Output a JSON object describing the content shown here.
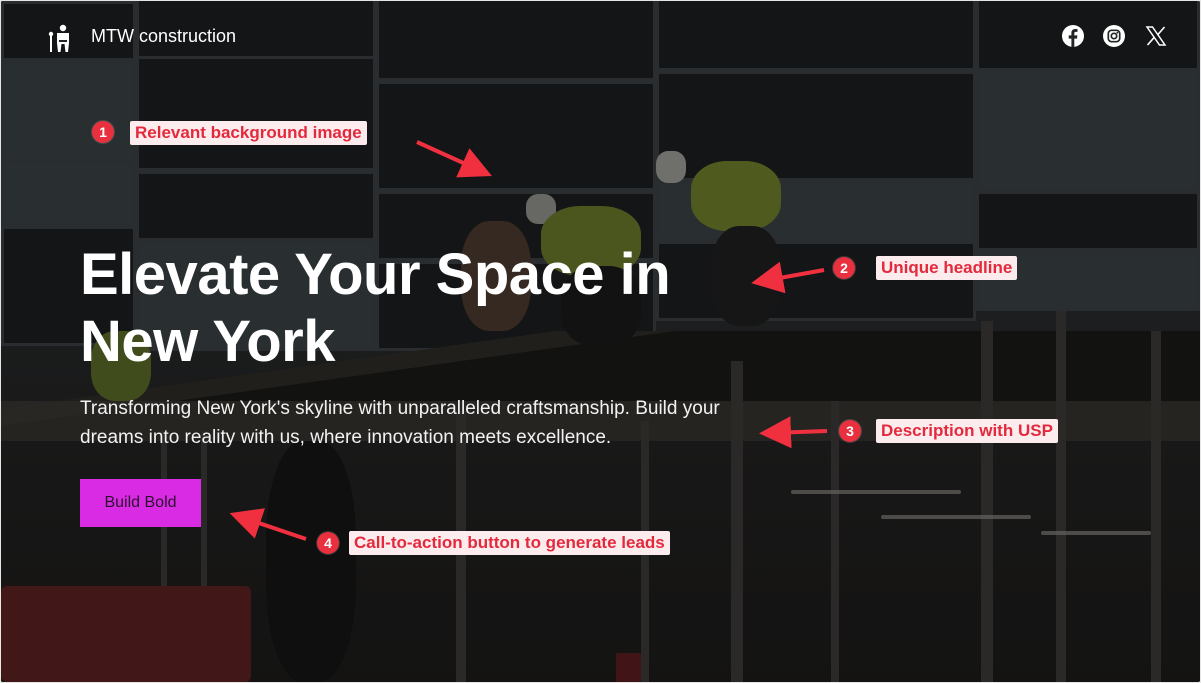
{
  "header": {
    "brand_name": "MTW construction",
    "logo_icon": "worker-figure-icon",
    "social_links": [
      {
        "name": "facebook",
        "icon": "facebook-icon"
      },
      {
        "name": "instagram",
        "icon": "instagram-icon"
      },
      {
        "name": "x",
        "icon": "x-icon"
      }
    ]
  },
  "hero": {
    "headline": "Elevate Your Space in New York",
    "description": "Transforming New York's skyline with unparalleled craftsmanship. Build your dreams into reality with us, where innovation meets excellence.",
    "cta_label": "Build Bold",
    "background_image": "construction workers on scaffolding in front of glass building"
  },
  "annotations": [
    {
      "number": "1",
      "label": "Relevant background image"
    },
    {
      "number": "2",
      "label": "Unique headline"
    },
    {
      "number": "3",
      "label": "Description with USP"
    },
    {
      "number": "4",
      "label": "Call-to-action button to generate leads"
    }
  ],
  "colors": {
    "cta_background": "#d92be3",
    "annotation_red": "#e8303f",
    "annotation_label_bg": "#fdecee",
    "text_white": "#ffffff"
  }
}
